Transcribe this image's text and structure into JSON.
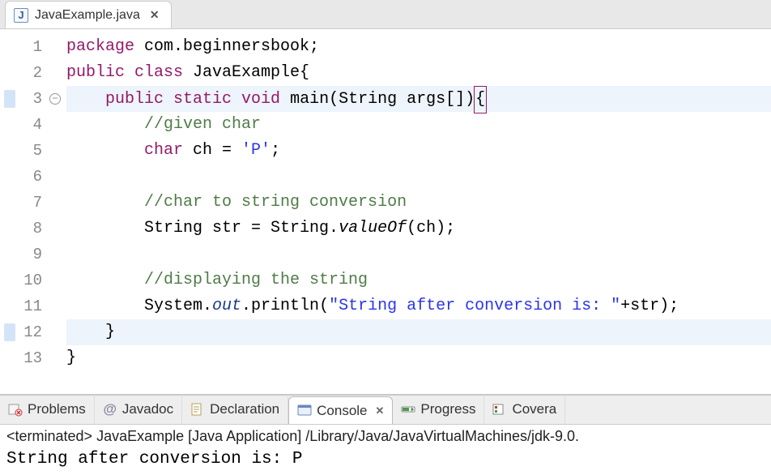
{
  "editorTab": {
    "title": "JavaExample.java",
    "iconLetter": "J"
  },
  "code": {
    "foldLine": 3,
    "markLines": [
      3,
      12
    ],
    "hlLines": [
      3,
      12
    ],
    "lines": [
      {
        "n": 1,
        "frags": [
          {
            "t": "package ",
            "c": "kw"
          },
          {
            "t": "com.beginnersbook;"
          }
        ]
      },
      {
        "n": 2,
        "frags": [
          {
            "t": "public class ",
            "c": "kw"
          },
          {
            "t": "JavaExample{"
          }
        ]
      },
      {
        "n": 3,
        "frags": [
          {
            "t": "    "
          },
          {
            "t": "public static void ",
            "c": "kw"
          },
          {
            "t": "main(String args[])"
          },
          {
            "t": "{",
            "c": "caret"
          }
        ]
      },
      {
        "n": 4,
        "frags": [
          {
            "t": "        "
          },
          {
            "t": "//given char",
            "c": "cm"
          }
        ]
      },
      {
        "n": 5,
        "frags": [
          {
            "t": "        "
          },
          {
            "t": "char ",
            "c": "kw"
          },
          {
            "t": "ch = "
          },
          {
            "t": "'P'",
            "c": "str"
          },
          {
            "t": ";"
          }
        ]
      },
      {
        "n": 6,
        "frags": []
      },
      {
        "n": 7,
        "frags": [
          {
            "t": "        "
          },
          {
            "t": "//char to string conversion",
            "c": "cm"
          }
        ]
      },
      {
        "n": 8,
        "frags": [
          {
            "t": "        String str = String."
          },
          {
            "t": "valueOf",
            "c": "mth"
          },
          {
            "t": "(ch);"
          }
        ]
      },
      {
        "n": 9,
        "frags": []
      },
      {
        "n": 10,
        "frags": [
          {
            "t": "        "
          },
          {
            "t": "//displaying the string",
            "c": "cm"
          }
        ]
      },
      {
        "n": 11,
        "frags": [
          {
            "t": "        System."
          },
          {
            "t": "out",
            "c": "fld"
          },
          {
            "t": ".println("
          },
          {
            "t": "\"String after conversion is: \"",
            "c": "str"
          },
          {
            "t": "+str);"
          }
        ]
      },
      {
        "n": 12,
        "frags": [
          {
            "t": "    }"
          }
        ]
      },
      {
        "n": 13,
        "frags": [
          {
            "t": "}"
          }
        ]
      }
    ]
  },
  "bottomTabs": {
    "problems": "Problems",
    "javadoc": "Javadoc",
    "declaration": "Declaration",
    "console": "Console",
    "progress": "Progress",
    "coverage": "Covera"
  },
  "console": {
    "header": "<terminated> JavaExample [Java Application] /Library/Java/JavaVirtualMachines/jdk-9.0.",
    "output": "String after conversion is: P"
  }
}
